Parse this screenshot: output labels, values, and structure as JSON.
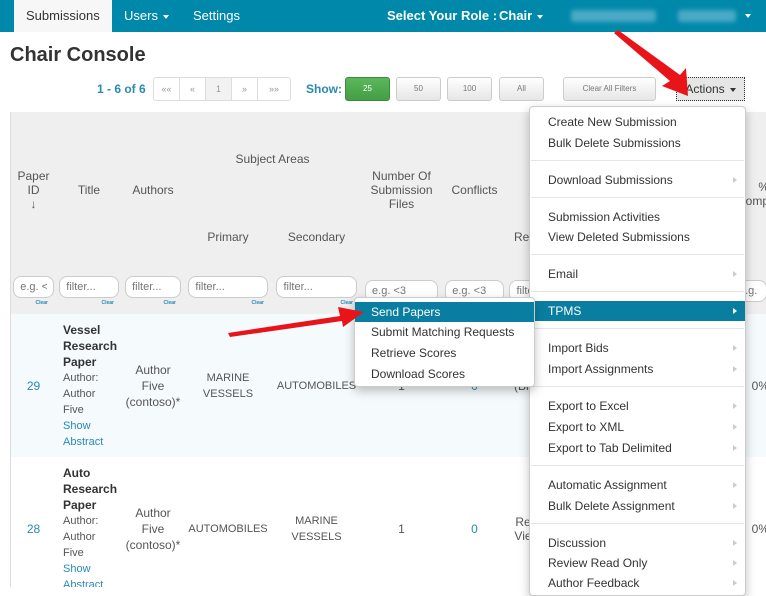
{
  "navbar": {
    "tabs": [
      {
        "label": "Submissions",
        "active": true
      },
      {
        "label": "Users",
        "dropdown": true
      },
      {
        "label": "Settings"
      }
    ],
    "role_label": "Select Your Role :",
    "role_value": "Chair"
  },
  "page": {
    "title": "Chair Console"
  },
  "toolbar": {
    "paging_info": "1 - 6 of 6",
    "pager": [
      "««",
      "«",
      "1",
      "»",
      "»»"
    ],
    "show_label": "Show:",
    "page_sizes": [
      "25",
      "50",
      "100",
      "All"
    ],
    "selected_page_size": "25",
    "clear_filters": "Clear All Filters",
    "actions": "Actions"
  },
  "table": {
    "headers": {
      "paper_id": "Paper ID",
      "sort_icon": "↓",
      "title": "Title",
      "authors": "Authors",
      "subject_areas": "Subject Areas",
      "primary": "Primary",
      "secondary": "Secondary",
      "num_files": "Number Of Submission Files",
      "conflicts": "Conflicts",
      "reviewers_partial": "Re",
      "completion_partial_1": "%",
      "completion_partial_2": "omp"
    },
    "filters": {
      "paper_id": "e.g. <",
      "title": "filter...",
      "authors": "filter...",
      "primary": "filter...",
      "secondary": "filter...",
      "num_files": "e.g. <3",
      "conflicts": "e.g. <3",
      "reviewers": "filte",
      "clear": "Clear"
    },
    "rows": [
      {
        "id": "29",
        "title": "Vessel Research Paper",
        "author_line1": "Author:",
        "author_line2": "Author",
        "author_line3": "Five",
        "show": "Show",
        "abstract": "Abstract",
        "authors": "Author Five (contoso)*",
        "primary": "MARINE VESSELS",
        "secondary": "AUTOMOBILES",
        "num_files": "1",
        "conflicts": "0",
        "reviewers": "(Bl Rev",
        "completion": "0%"
      },
      {
        "id": "28",
        "title": "Auto Research Paper",
        "author_line1": "Author:",
        "author_line2": "Author",
        "author_line3": "Five",
        "show": "Show",
        "abstract": "Abstract",
        "authors": "Author Five (contoso)*",
        "primary": "AUTOMOBILES",
        "secondary": "MARINE VESSELS",
        "num_files": "1",
        "conflicts": "0",
        "reviewers": "Rev Viev",
        "completion": "0%"
      }
    ]
  },
  "actions_menu": {
    "items": [
      {
        "label": "Create New Submission"
      },
      {
        "label": "Bulk Delete Submissions"
      },
      {
        "label": "Download Submissions",
        "submenu": true
      },
      {
        "label": "Submission Activities"
      },
      {
        "label": "View Deleted Submissions"
      },
      {
        "label": "Email",
        "submenu": true
      },
      {
        "label": "TPMS",
        "submenu": true,
        "active": true
      },
      {
        "label": "Import Bids",
        "submenu": true
      },
      {
        "label": "Import Assignments",
        "submenu": true
      },
      {
        "label": "Export to Excel",
        "submenu": true
      },
      {
        "label": "Export to XML",
        "submenu": true
      },
      {
        "label": "Export to Tab Delimited",
        "submenu": true
      },
      {
        "label": "Automatic Assignment",
        "submenu": true
      },
      {
        "label": "Bulk Delete Assignment",
        "submenu": true
      },
      {
        "label": "Discussion",
        "submenu": true
      },
      {
        "label": "Review Read Only",
        "submenu": true
      },
      {
        "label": "Author Feedback",
        "submenu": true
      }
    ]
  },
  "tpms_submenu": {
    "items": [
      {
        "label": "Send Papers",
        "active": true
      },
      {
        "label": "Submit Matching Requests"
      },
      {
        "label": "Retrieve Scores"
      },
      {
        "label": "Download Scores"
      }
    ]
  },
  "colors": {
    "navbar": "#0088aa",
    "accent": "#0a7ea0",
    "link": "#2a8ab0",
    "green": "#5cb85c",
    "annotation_arrow": "#e8141a"
  }
}
